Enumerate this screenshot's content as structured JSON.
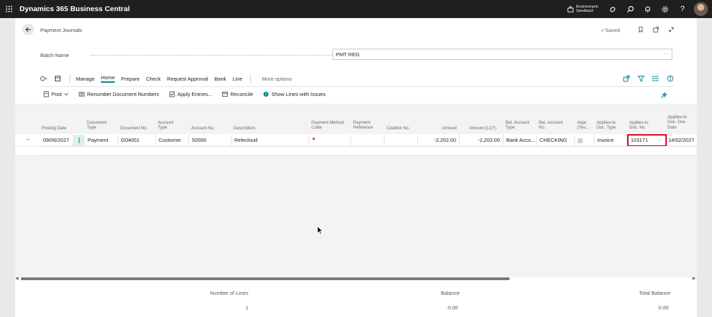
{
  "app": {
    "title": "Dynamics 365 Business Central",
    "environment_label": "Environment:",
    "environment_name": "Sandbox2"
  },
  "page": {
    "title": "Payment Journals",
    "saved_status": "✓Saved"
  },
  "batch": {
    "label": "Batch Name",
    "value": "PMT REG"
  },
  "actions": {
    "tabs": [
      "Manage",
      "Home",
      "Prepare",
      "Check",
      "Request Approval",
      "Bank",
      "Line"
    ],
    "active_tab": "Home",
    "more": "More options"
  },
  "subactions": {
    "post": "Post",
    "renumber": "Renumber Document Numbers",
    "apply": "Apply Entries...",
    "reconcile": "Reconcile",
    "show_issues": "Show Lines with Issues"
  },
  "grid": {
    "columns": {
      "posting_date": [
        "Posting Date"
      ],
      "document_type": [
        "Document",
        "Type"
      ],
      "document_no": [
        "Document No."
      ],
      "account_type": [
        "Account",
        "Type"
      ],
      "account_no": [
        "Account No."
      ],
      "description": [
        "Description"
      ],
      "payment_method": [
        "Payment Method",
        "Code"
      ],
      "payment_reference": [
        "Payment",
        "Reference"
      ],
      "creditor_no": [
        "Creditor No."
      ],
      "amount": [
        "Amount"
      ],
      "amount_lcy": [
        "Amount (LCY)"
      ],
      "bal_account_type": [
        "Bal. Account",
        "Type"
      ],
      "bal_account_no": [
        "Bal. Account",
        "No."
      ],
      "approved": [
        "Appr.",
        "(Yes..."
      ],
      "applies_to_doc_type": [
        "Applies-to",
        "Doc. Type"
      ],
      "applies_to_doc_no": [
        "Applies-to",
        "Doc. No."
      ],
      "applies_to_due_date": [
        "Applies-to",
        "Doc. Due",
        "Date"
      ]
    },
    "row": {
      "posting_date": "09/06/2027",
      "document_type": "Payment",
      "document_no": "G04001",
      "account_type": "Customer",
      "account_no": "50000",
      "description": "Relecloud",
      "payment_method": "*",
      "amount": "-2,202.00",
      "amount_lcy": "-2,202.00",
      "bal_account_type": "Bank Acco...",
      "bal_account_no": "CHECKING",
      "applies_to_doc_type": "Invoice",
      "applies_to_doc_no": "103171",
      "applies_to_due_date": "14/02/2027"
    }
  },
  "totals": {
    "number_of_lines_label": "Number of Lines",
    "number_of_lines": "1",
    "balance_label": "Balance",
    "balance": "0.00",
    "total_balance_label": "Total Balance",
    "total_balance": "0.00"
  }
}
